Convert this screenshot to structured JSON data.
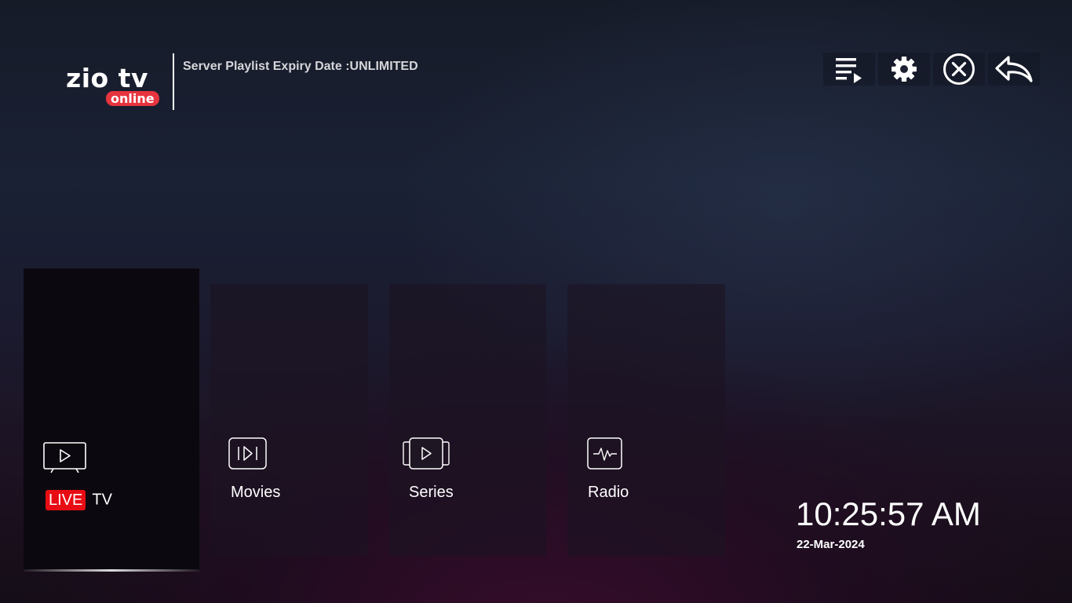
{
  "header": {
    "logo_text": "zio tv",
    "logo_badge": "online",
    "expiry_text": "Server Playlist Expiry Date :UNLIMITED"
  },
  "toolbar": [
    {
      "name": "playlist",
      "icon": "playlist-play-icon"
    },
    {
      "name": "settings",
      "icon": "gear-icon"
    },
    {
      "name": "exit",
      "icon": "close-circle-icon"
    },
    {
      "name": "back",
      "icon": "reply-arrow-icon"
    }
  ],
  "tiles": {
    "live": {
      "badge": "LIVE",
      "label": "TV",
      "icon": "tv-play-icon",
      "selected": true
    },
    "movies": {
      "label": "Movies",
      "icon": "skip-play-icon"
    },
    "series": {
      "label": "Series",
      "icon": "stacked-play-icon"
    },
    "radio": {
      "label": "Radio",
      "icon": "pulse-wave-icon"
    }
  },
  "clock": {
    "time": "10:25:57 AM",
    "date": "22-Mar-2024"
  },
  "colors": {
    "accent_red": "#e80d14",
    "logo_badge": "#e7343f",
    "text_primary": "#ffffff",
    "text_secondary": "#d6d6da"
  }
}
